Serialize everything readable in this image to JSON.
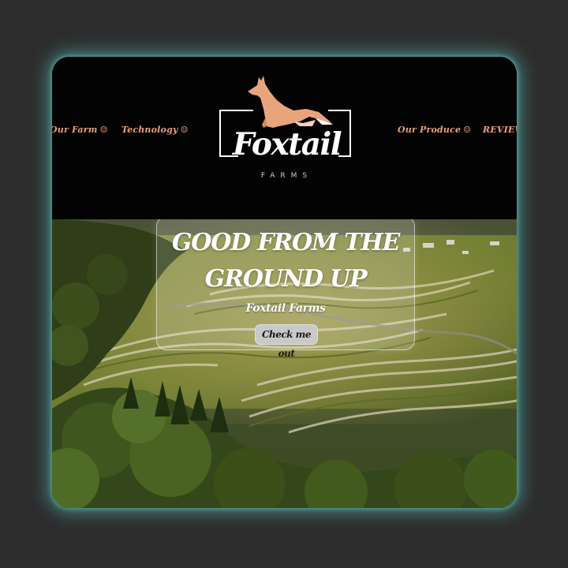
{
  "nav": {
    "left_items": [
      {
        "label": "Our Farm",
        "icon": "smile-icon"
      },
      {
        "label": "Technology",
        "icon": "smile-icon"
      }
    ],
    "right_items": [
      {
        "label": "Our Produce",
        "icon": "smile-icon"
      },
      {
        "label": "REVIEWS"
      }
    ],
    "smile_glyph": "☺"
  },
  "logo": {
    "title": "Foxtail",
    "subtitle": "FARMS",
    "fox_color": "#e8a57c"
  },
  "hero": {
    "headline_line1": "GOOD FROM THE",
    "headline_line2": "GROUND UP",
    "subtitle": "Foxtail Farms",
    "cta_label": "Check me out"
  },
  "colors": {
    "page_bg": "#2d2d2d",
    "glow": "#56c4be",
    "nav_text": "#e8a179",
    "header_bg": "#030303"
  }
}
